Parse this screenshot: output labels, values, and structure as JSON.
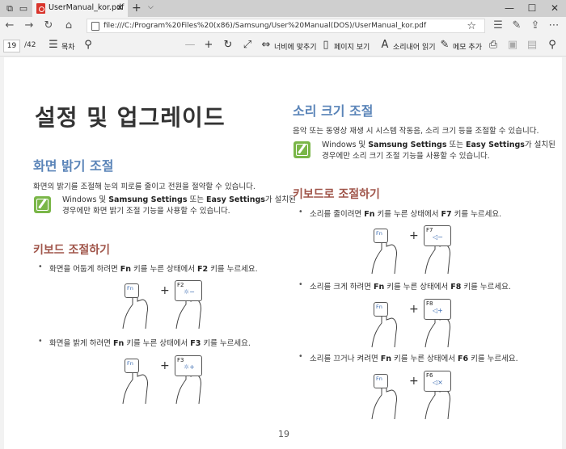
{
  "window": {
    "tab_title": "UserManual_kor.pdf",
    "url": "file:///C:/Program%20Files%20(x86)/Samsung/User%20Manual(DOS)/UserManual_kor.pdf"
  },
  "pdf_toolbar": {
    "page_current": "19",
    "page_total": "/42",
    "toc": "목차",
    "fit_width": "너비에 맞추기",
    "page_view": "페이지 보기",
    "read_aloud": "소리내어 읽기",
    "add_note": "메모 추가"
  },
  "doc": {
    "title": "설정 및 업그레이드",
    "brightness": {
      "heading": "화면 밝기 조절",
      "intro": "화면의 밝기를 조절해 눈의 피로를 줄이고 전원을 절약할 수 있습니다.",
      "note_pre": "Windows 및 ",
      "note_b1": "Samsung Settings",
      "note_mid": " 또는 ",
      "note_b2": "Easy Settings",
      "note_post": "가 설치된",
      "note_line2": "경우에만 화면 밝기 조절 기능을 사용할 수 있습니다.",
      "kb_heading": "키보드 조절하기",
      "b1_pre": "화면을 어둡게 하려면 ",
      "b1_fn": "Fn",
      "b1_mid": " 키를 누른 상태에서 ",
      "b1_key": "F2",
      "b1_post": " 키를 누르세요.",
      "b2_pre": "화면을 밝게 하려면 ",
      "b2_fn": "Fn",
      "b2_mid": " 키를 누른 상태에서 ",
      "b2_key": "F3",
      "b2_post": " 키를 누르세요."
    },
    "volume": {
      "heading": "소리 크기 조절",
      "intro": "음악 또는 동영상 재생 시 시스템 작동음, 소리 크기 등을 조절할 수 있습니다.",
      "note_pre": "Windows 및 ",
      "note_b1": "Samsung Settings",
      "note_mid": " 또는 ",
      "note_b2": "Easy Settings",
      "note_post": "가 설치된",
      "note_line2": "경우에만 소리 크기 조절 기능을 사용할 수 있습니다.",
      "kb_heading": "키보드로 조절하기",
      "b1_pre": "소리를 줄이려면 ",
      "b1_fn": "Fn",
      "b1_mid": " 키를 누른 상태에서 ",
      "b1_key": "F7",
      "b1_post": " 키를 누르세요.",
      "b2_pre": "소리를 크게 하려면 ",
      "b2_fn": "Fn",
      "b2_mid": " 키를 누른 상태에서 ",
      "b2_key": "F8",
      "b2_post": " 키를 누르세요.",
      "b3_pre": "소리를 끄거나 켜려면 ",
      "b3_fn": "Fn",
      "b3_mid": " 키를 누른 상태에서 ",
      "b3_key": "F6",
      "b3_post": " 키를 누르세요."
    },
    "keys": {
      "fn": "Fn",
      "f2": "F2",
      "f3": "F3",
      "f7": "F7",
      "f8": "F8",
      "f6": "F6",
      "plus": "+"
    },
    "page_number": "19"
  }
}
